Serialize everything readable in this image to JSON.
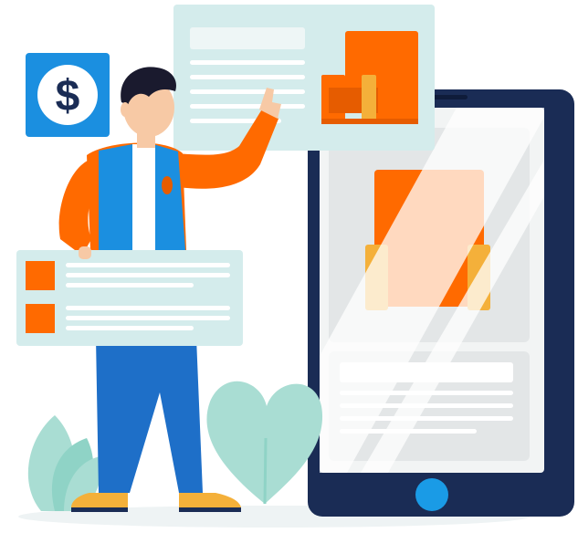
{
  "illustration": {
    "currency_symbol": "$",
    "colors": {
      "orange": "#ff6a00",
      "orange_dark": "#e65c00",
      "navy": "#1a2c55",
      "blue": "#1e6fc8",
      "blue_light": "#1b8fe0",
      "mint": "#d4ecec",
      "leaf_teal": "#8fd3c6",
      "skin": "#f7c9a5",
      "shoe_yellow": "#f4b03a",
      "hair": "#1a1a2e",
      "button_blue": "#1a9be6"
    },
    "icons": [
      "dollar-icon",
      "armchair-icon",
      "product-box-icon",
      "leaf-plant-icon",
      "home-button-icon"
    ]
  }
}
